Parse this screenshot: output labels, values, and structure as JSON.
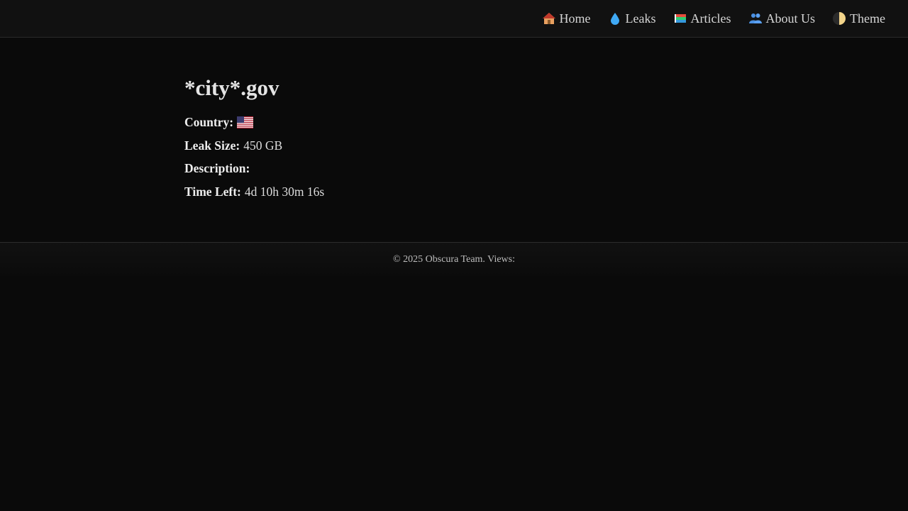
{
  "nav": {
    "items": [
      {
        "label": "Home",
        "icon": "house-icon"
      },
      {
        "label": "Leaks",
        "icon": "droplet-icon"
      },
      {
        "label": "Articles",
        "icon": "books-icon"
      },
      {
        "label": "About Us",
        "icon": "people-icon"
      },
      {
        "label": "Theme",
        "icon": "half-moon-icon"
      }
    ]
  },
  "leak": {
    "title": "*city*.gov",
    "country_label": "Country:",
    "country_flag": "us-flag-icon",
    "size_label": "Leak Size:",
    "size_value": "450 GB",
    "description_label": "Description:",
    "description_value": "",
    "time_left_label": "Time Left:",
    "time_left_value": "4d 10h 30m 16s"
  },
  "footer": {
    "text": "© 2025 Obscura Team. Views:"
  }
}
